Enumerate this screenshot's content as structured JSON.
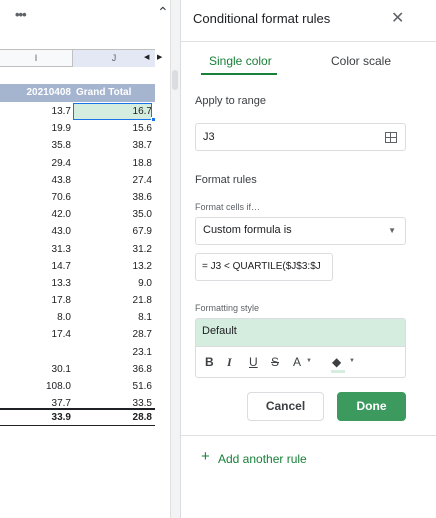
{
  "sheet": {
    "more_label": "•••",
    "columns": [
      "I",
      "J"
    ],
    "header": {
      "col_i": "20210408",
      "col_j": "Grand Total"
    },
    "rows": [
      {
        "i": "13.7",
        "j": "16.7"
      },
      {
        "i": "19.9",
        "j": "15.6"
      },
      {
        "i": "35.8",
        "j": "38.7"
      },
      {
        "i": "29.4",
        "j": "18.8"
      },
      {
        "i": "43.8",
        "j": "27.4"
      },
      {
        "i": "70.6",
        "j": "38.6"
      },
      {
        "i": "42.0",
        "j": "35.0"
      },
      {
        "i": "43.0",
        "j": "67.9"
      },
      {
        "i": "31.3",
        "j": "31.2"
      },
      {
        "i": "14.7",
        "j": "13.2"
      },
      {
        "i": "13.3",
        "j": "9.0"
      },
      {
        "i": "17.8",
        "j": "21.8"
      },
      {
        "i": "8.0",
        "j": "8.1"
      },
      {
        "i": "17.4",
        "j": "28.7"
      },
      {
        "i": "",
        "j": "23.1"
      },
      {
        "i": "30.1",
        "j": "36.8"
      },
      {
        "i": "108.0",
        "j": "51.6"
      },
      {
        "i": "37.7",
        "j": "33.5"
      }
    ],
    "total": {
      "i": "33.9",
      "j": "28.8"
    },
    "selected_row": 0,
    "highlight_color": "#d4edde",
    "header_color": "#a5b4cf"
  },
  "panel": {
    "title": "Conditional format rules",
    "tabs": [
      {
        "label": "Single color",
        "active": true
      },
      {
        "label": "Color scale",
        "active": false
      }
    ],
    "apply_to_range_label": "Apply to range",
    "range_value": "J3",
    "format_rules_label": "Format rules",
    "format_cells_if_label": "Format cells if…",
    "condition_value": "Custom formula is",
    "formula_value": "= J3 < QUARTILE($J$3:$J",
    "formatting_style_label": "Formatting style",
    "style_preview": "Default",
    "toolbar": {
      "bold": "B",
      "italic": "I",
      "underline": "U",
      "strike": "S",
      "text_color": "A",
      "fill_color": "◆"
    },
    "cancel_label": "Cancel",
    "done_label": "Done",
    "add_rule_label": "Add another rule",
    "accent_color": "#188038",
    "done_color": "#3c9a5f"
  }
}
